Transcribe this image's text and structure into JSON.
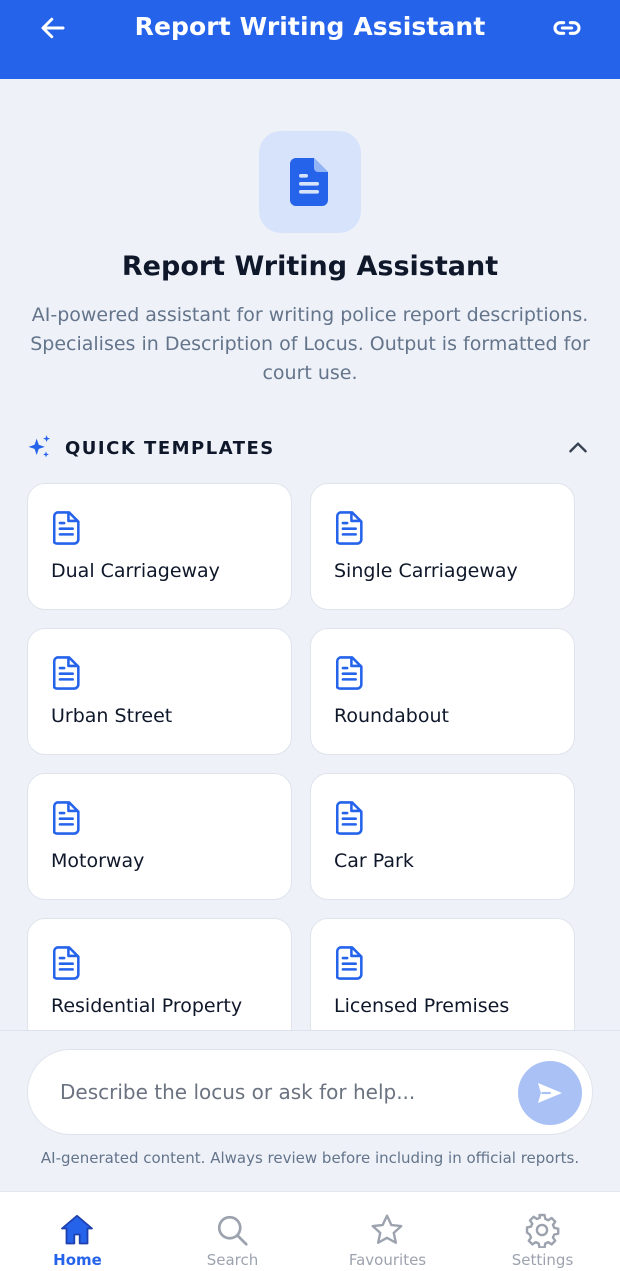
{
  "header": {
    "title": "Report Writing Assistant",
    "back_icon": "arrow-left-icon",
    "link_icon": "link-icon"
  },
  "hero": {
    "icon": "document-icon",
    "title": "Report Writing Assistant",
    "description": "AI-powered assistant for writing police report descriptions. Specialises in Description of Locus. Output is formatted for court use."
  },
  "templates": {
    "heading": "QUICK TEMPLATES",
    "items": [
      {
        "label": "Dual Carriageway"
      },
      {
        "label": "Single Carriageway"
      },
      {
        "label": "Urban Street"
      },
      {
        "label": "Roundabout"
      },
      {
        "label": "Motorway"
      },
      {
        "label": "Car Park"
      },
      {
        "label": "Residential Property"
      },
      {
        "label": "Licensed Premises"
      }
    ]
  },
  "composer": {
    "placeholder": "Describe the locus or ask for help...",
    "value": "",
    "disclaimer": "AI-generated content. Always review before including in official reports."
  },
  "nav": {
    "items": [
      {
        "label": "Home",
        "icon": "home-icon",
        "active": true
      },
      {
        "label": "Search",
        "icon": "search-icon",
        "active": false
      },
      {
        "label": "Favourites",
        "icon": "star-icon",
        "active": false
      },
      {
        "label": "Settings",
        "icon": "gear-icon",
        "active": false
      }
    ]
  },
  "colors": {
    "primary": "#2563eb",
    "background": "#eef2f8",
    "send_disabled": "#a9c1f5",
    "hero_icon_bg": "#d7e3fb",
    "muted_text": "#64748b"
  }
}
